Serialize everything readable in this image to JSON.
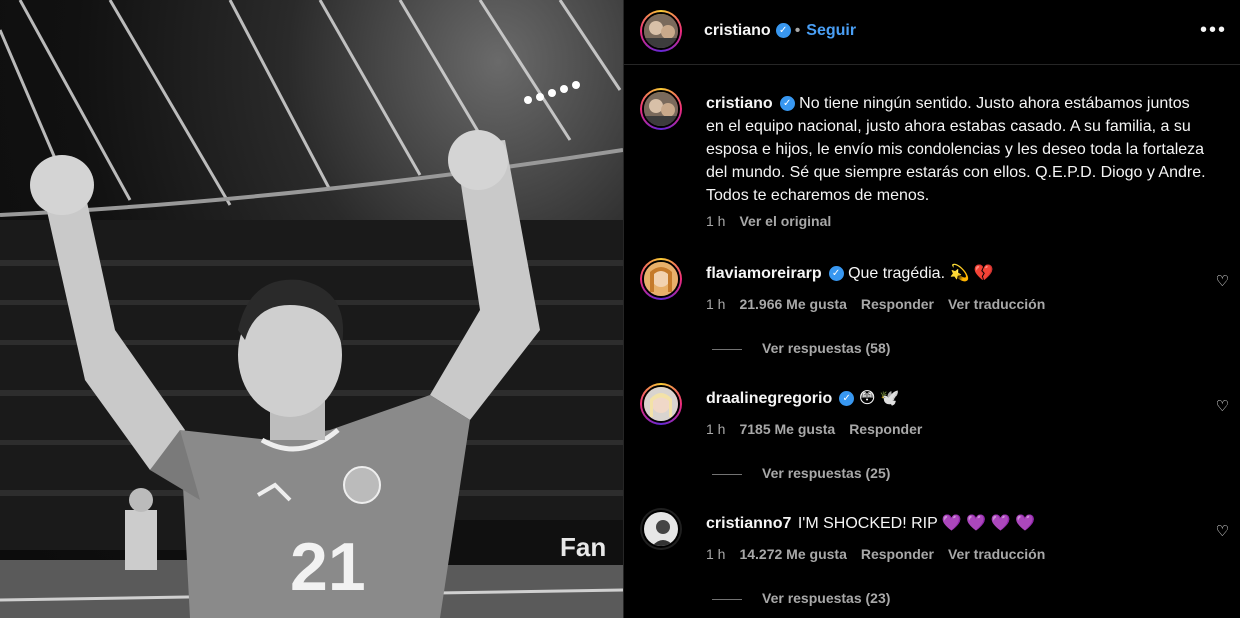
{
  "post": {
    "author": "cristiano",
    "separator": "•",
    "follow_label": "Seguir",
    "more_label": "•••",
    "player_number": "21",
    "banner_text": "Fan"
  },
  "caption": {
    "username": "cristiano",
    "text": "No tiene ningún sentido. Justo ahora estábamos juntos en el equipo nacional, justo ahora estabas casado. A su familia, a su esposa e hijos, le envío mis condolencias y les deseo toda la fortaleza del mundo. Sé que siempre estarás con ellos. Q.E.P.D. Diogo y Andre. Todos te echaremos de menos.",
    "time": "1 h",
    "see_original": "Ver el original"
  },
  "comments": [
    {
      "username": "flaviamoreirarp",
      "verified": true,
      "text": "Que tragédia. 💫 💔",
      "time": "1 h",
      "likes": "21.966 Me gusta",
      "reply": "Responder",
      "translate": "Ver traducción",
      "view_replies": "Ver respuestas (58)"
    },
    {
      "username": "draalinegregorio",
      "verified": true,
      "text": "😳 🕊️",
      "time": "1 h",
      "likes": "7185 Me gusta",
      "reply": "Responder",
      "translate": "",
      "view_replies": "Ver respuestas (25)"
    },
    {
      "username": "cristianno7",
      "verified": false,
      "text": "I'M SHOCKED! RIP 💜 💜 💜 💜",
      "time": "1 h",
      "likes": "14.272 Me gusta",
      "reply": "Responder",
      "translate": "Ver traducción",
      "view_replies": "Ver respuestas (23)"
    }
  ],
  "icons": {
    "verified": "✓",
    "heart": "♡"
  },
  "colors": {
    "link": "#4a9ff5",
    "muted": "#a8a8a8",
    "verified": "#3897f0"
  }
}
